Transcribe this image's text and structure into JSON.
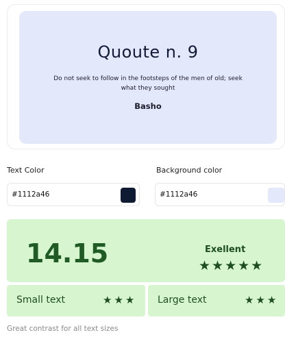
{
  "preview": {
    "title": "Quoute n. 9",
    "quote": "Do not seek to follow in the footsteps of the men of old; seek what they sought",
    "author": "Basho"
  },
  "text_color": {
    "label": "Text Color",
    "value": "#1112a46",
    "swatch": "#0f1b33"
  },
  "background_color": {
    "label": "Background color",
    "value": "#1112a46",
    "swatch": "#e3e9fb"
  },
  "contrast": {
    "score": "14.15",
    "rating_label": "Exellent",
    "rating_stars": "★★★★★",
    "small_text": {
      "label": "Small text",
      "stars": "★★★"
    },
    "large_text": {
      "label": "Large text",
      "stars": "★★★"
    },
    "note": "Great contrast for all text sizes"
  },
  "colors": {
    "result_bg": "#d7f6d0",
    "result_fg": "#205a25"
  }
}
